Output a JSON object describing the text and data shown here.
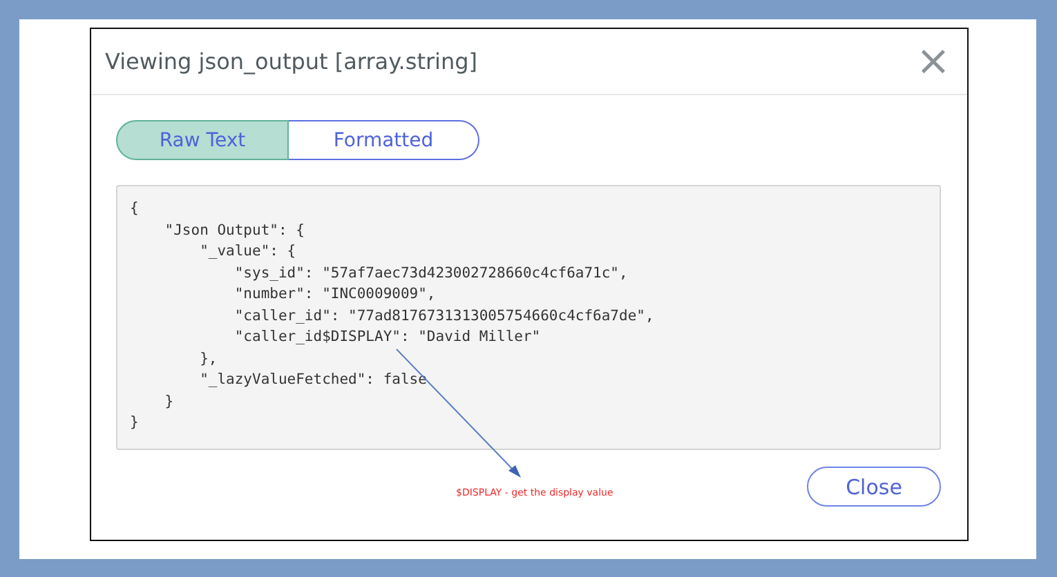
{
  "dialog": {
    "title": "Viewing json_output [array.string]",
    "close_icon": "×"
  },
  "tabs": [
    {
      "label": "Raw Text",
      "selected": true
    },
    {
      "label": "Formatted",
      "selected": false
    }
  ],
  "code_lines": [
    "{",
    "    \"Json Output\": {",
    "        \"_value\": {",
    "            \"sys_id\": \"57af7aec73d423002728660c4cf6a71c\",",
    "            \"number\": \"INC0009009\",",
    "            \"caller_id\": \"77ad8176731313005754660c4cf6a7de\",",
    "            \"caller_id$DISPLAY\": \"David Miller\"",
    "        },",
    "        \"_lazyValueFetched\": false",
    "    }",
    "}"
  ],
  "annotation": "$DISPLAY - get the display value",
  "buttons": [
    "Close"
  ]
}
